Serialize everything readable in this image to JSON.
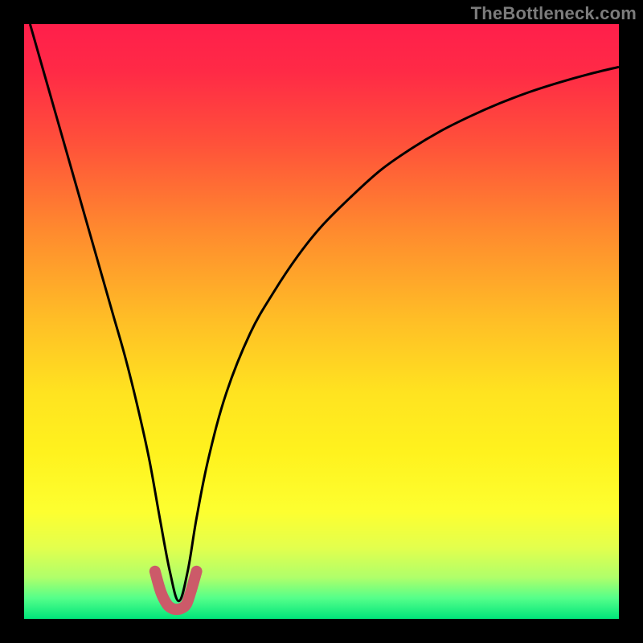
{
  "watermark": "TheBottleneck.com",
  "chart_data": {
    "type": "line",
    "title": "",
    "xlabel": "",
    "ylabel": "",
    "xlim": [
      0,
      100
    ],
    "ylim": [
      0,
      100
    ],
    "grid": false,
    "gradient_stops": [
      {
        "offset": 0.0,
        "color": "#ff1f4b"
      },
      {
        "offset": 0.08,
        "color": "#ff2a46"
      },
      {
        "offset": 0.2,
        "color": "#ff513a"
      },
      {
        "offset": 0.35,
        "color": "#ff8b2e"
      },
      {
        "offset": 0.5,
        "color": "#ffbf26"
      },
      {
        "offset": 0.62,
        "color": "#ffe320"
      },
      {
        "offset": 0.72,
        "color": "#fff21e"
      },
      {
        "offset": 0.82,
        "color": "#fdff30"
      },
      {
        "offset": 0.88,
        "color": "#e3ff4d"
      },
      {
        "offset": 0.93,
        "color": "#b0ff6a"
      },
      {
        "offset": 0.965,
        "color": "#55ff8a"
      },
      {
        "offset": 1.0,
        "color": "#00e57a"
      }
    ],
    "series": [
      {
        "name": "bottleneck-curve",
        "color": "#000000",
        "stroke_width": 3,
        "x": [
          1,
          3,
          5,
          7,
          9,
          11,
          13,
          15,
          17,
          19,
          21,
          22.8,
          24.5,
          26,
          27.5,
          29,
          31,
          34,
          38,
          42,
          46,
          50,
          55,
          60,
          65,
          70,
          75,
          80,
          85,
          90,
          95,
          100
        ],
        "y": [
          100,
          93,
          86,
          79,
          72,
          65,
          58,
          51,
          44,
          36,
          27,
          17,
          8,
          3,
          8,
          17,
          27,
          38,
          48,
          55,
          61,
          66,
          71,
          75.5,
          79,
          82,
          84.5,
          86.7,
          88.6,
          90.2,
          91.6,
          92.8
        ]
      },
      {
        "name": "notch-marker",
        "color": "#cc5a69",
        "stroke_width": 14,
        "linecap": "round",
        "x": [
          22.0,
          23.0,
          24.0,
          24.8,
          25.6,
          26.5,
          27.3,
          28.0,
          29.0
        ],
        "y": [
          8.0,
          4.5,
          2.5,
          1.8,
          1.6,
          1.8,
          2.5,
          4.5,
          8.0
        ]
      }
    ]
  }
}
